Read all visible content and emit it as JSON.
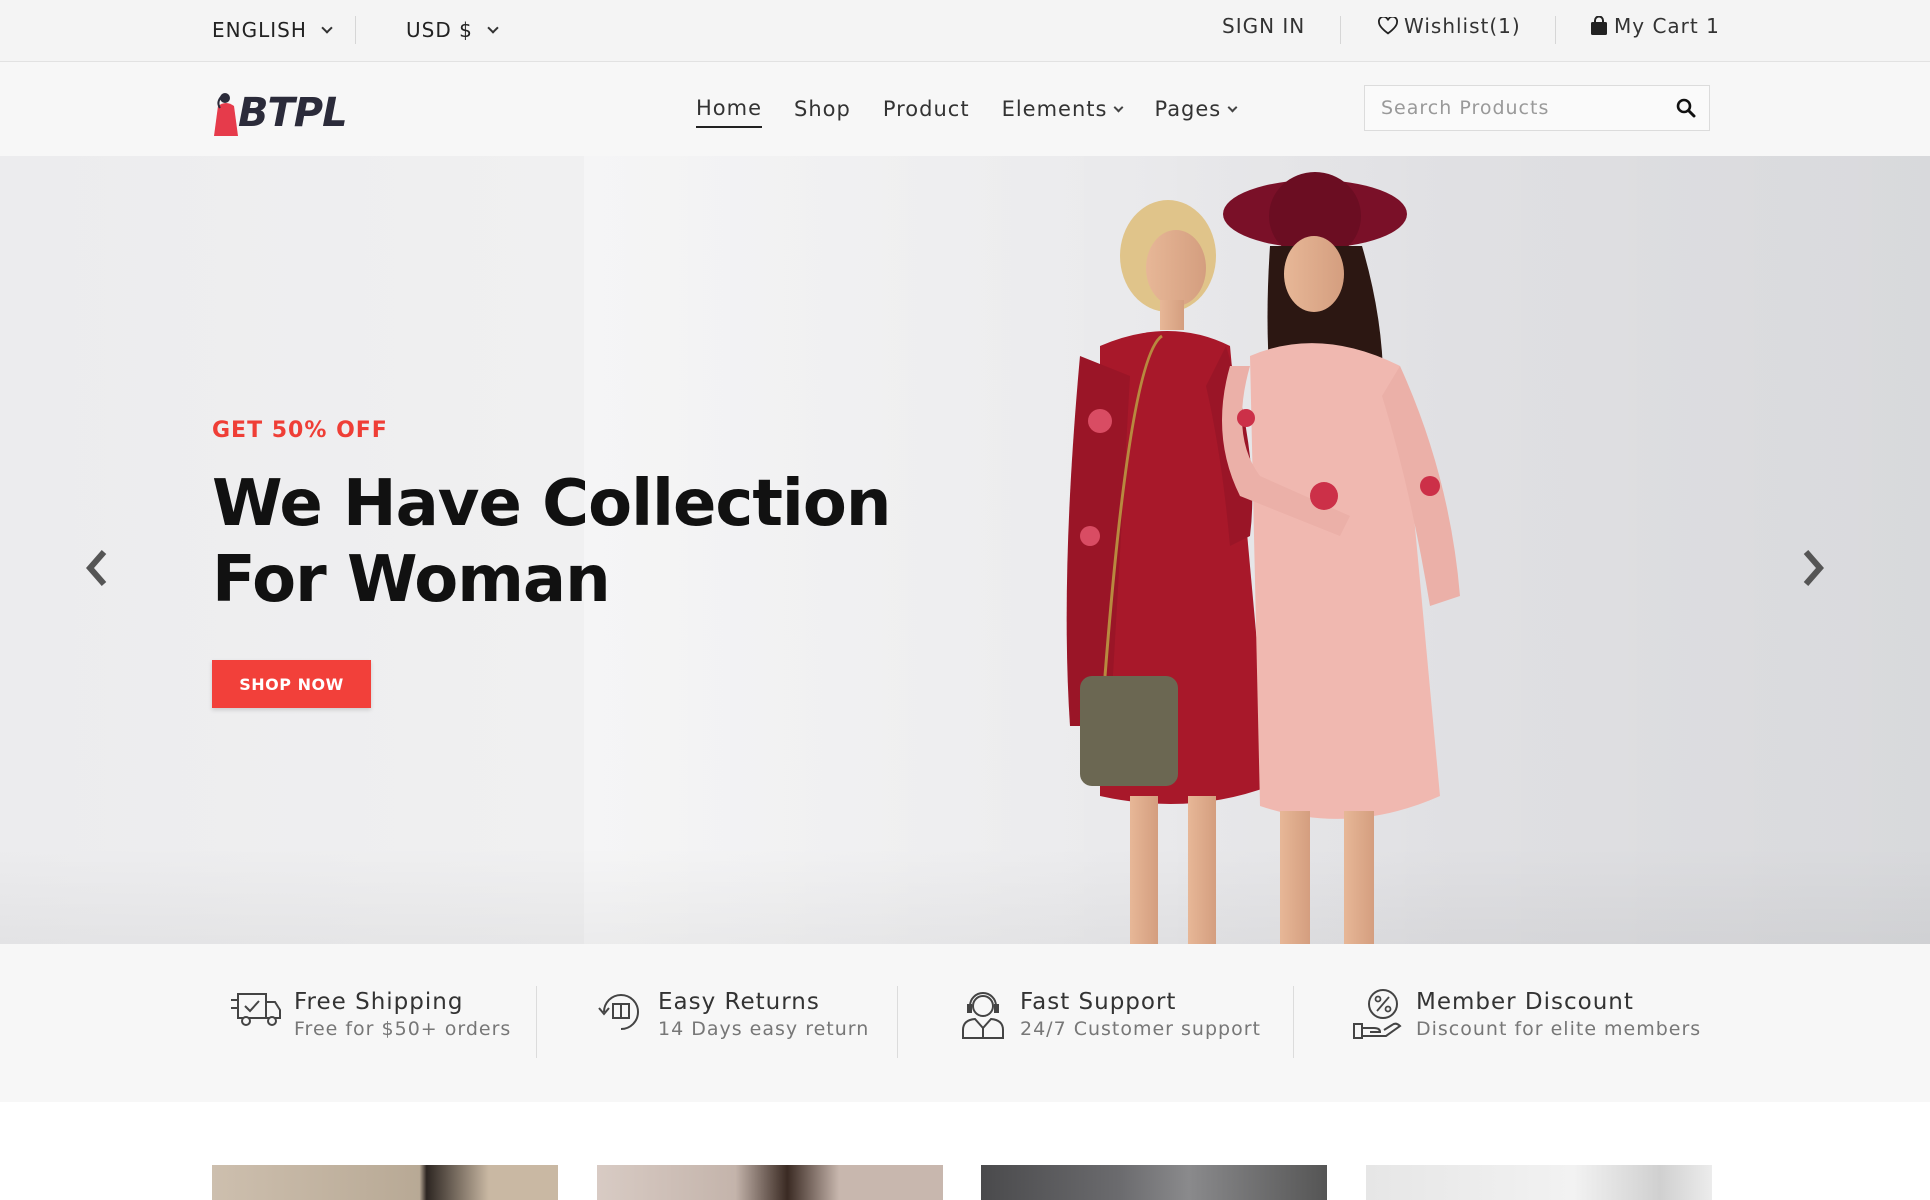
{
  "topbar": {
    "language": "ENGLISH",
    "currency": "USD $",
    "sign_in": "SIGN IN",
    "wishlist": "Wishlist(1)",
    "cart": "My Cart 1"
  },
  "header": {
    "logo_text": "BTPL",
    "nav": [
      {
        "label": "Home",
        "active": true
      },
      {
        "label": "Shop"
      },
      {
        "label": "Product"
      },
      {
        "label": "Elements",
        "dropdown": true
      },
      {
        "label": "Pages",
        "dropdown": true
      }
    ],
    "search_placeholder": "Search Products"
  },
  "hero": {
    "kicker": "GET 50% OFF",
    "headline_line1": "We Have Collection",
    "headline_line2": "For Woman",
    "cta": "SHOP NOW"
  },
  "features": [
    {
      "title": "Free Shipping",
      "subtitle": "Free for $50+ orders",
      "icon": "truck-icon"
    },
    {
      "title": "Easy Returns",
      "subtitle": "14 Days easy return",
      "icon": "return-box-icon"
    },
    {
      "title": "Fast Support",
      "subtitle": "24/7 Customer support",
      "icon": "support-agent-icon"
    },
    {
      "title": "Member Discount",
      "subtitle": "Discount for elite members",
      "icon": "discount-hand-icon"
    }
  ],
  "colors": {
    "accent": "#ef3e36",
    "topbar_bg": "#f4f4f4",
    "feature_bg": "#f7f7f7"
  }
}
